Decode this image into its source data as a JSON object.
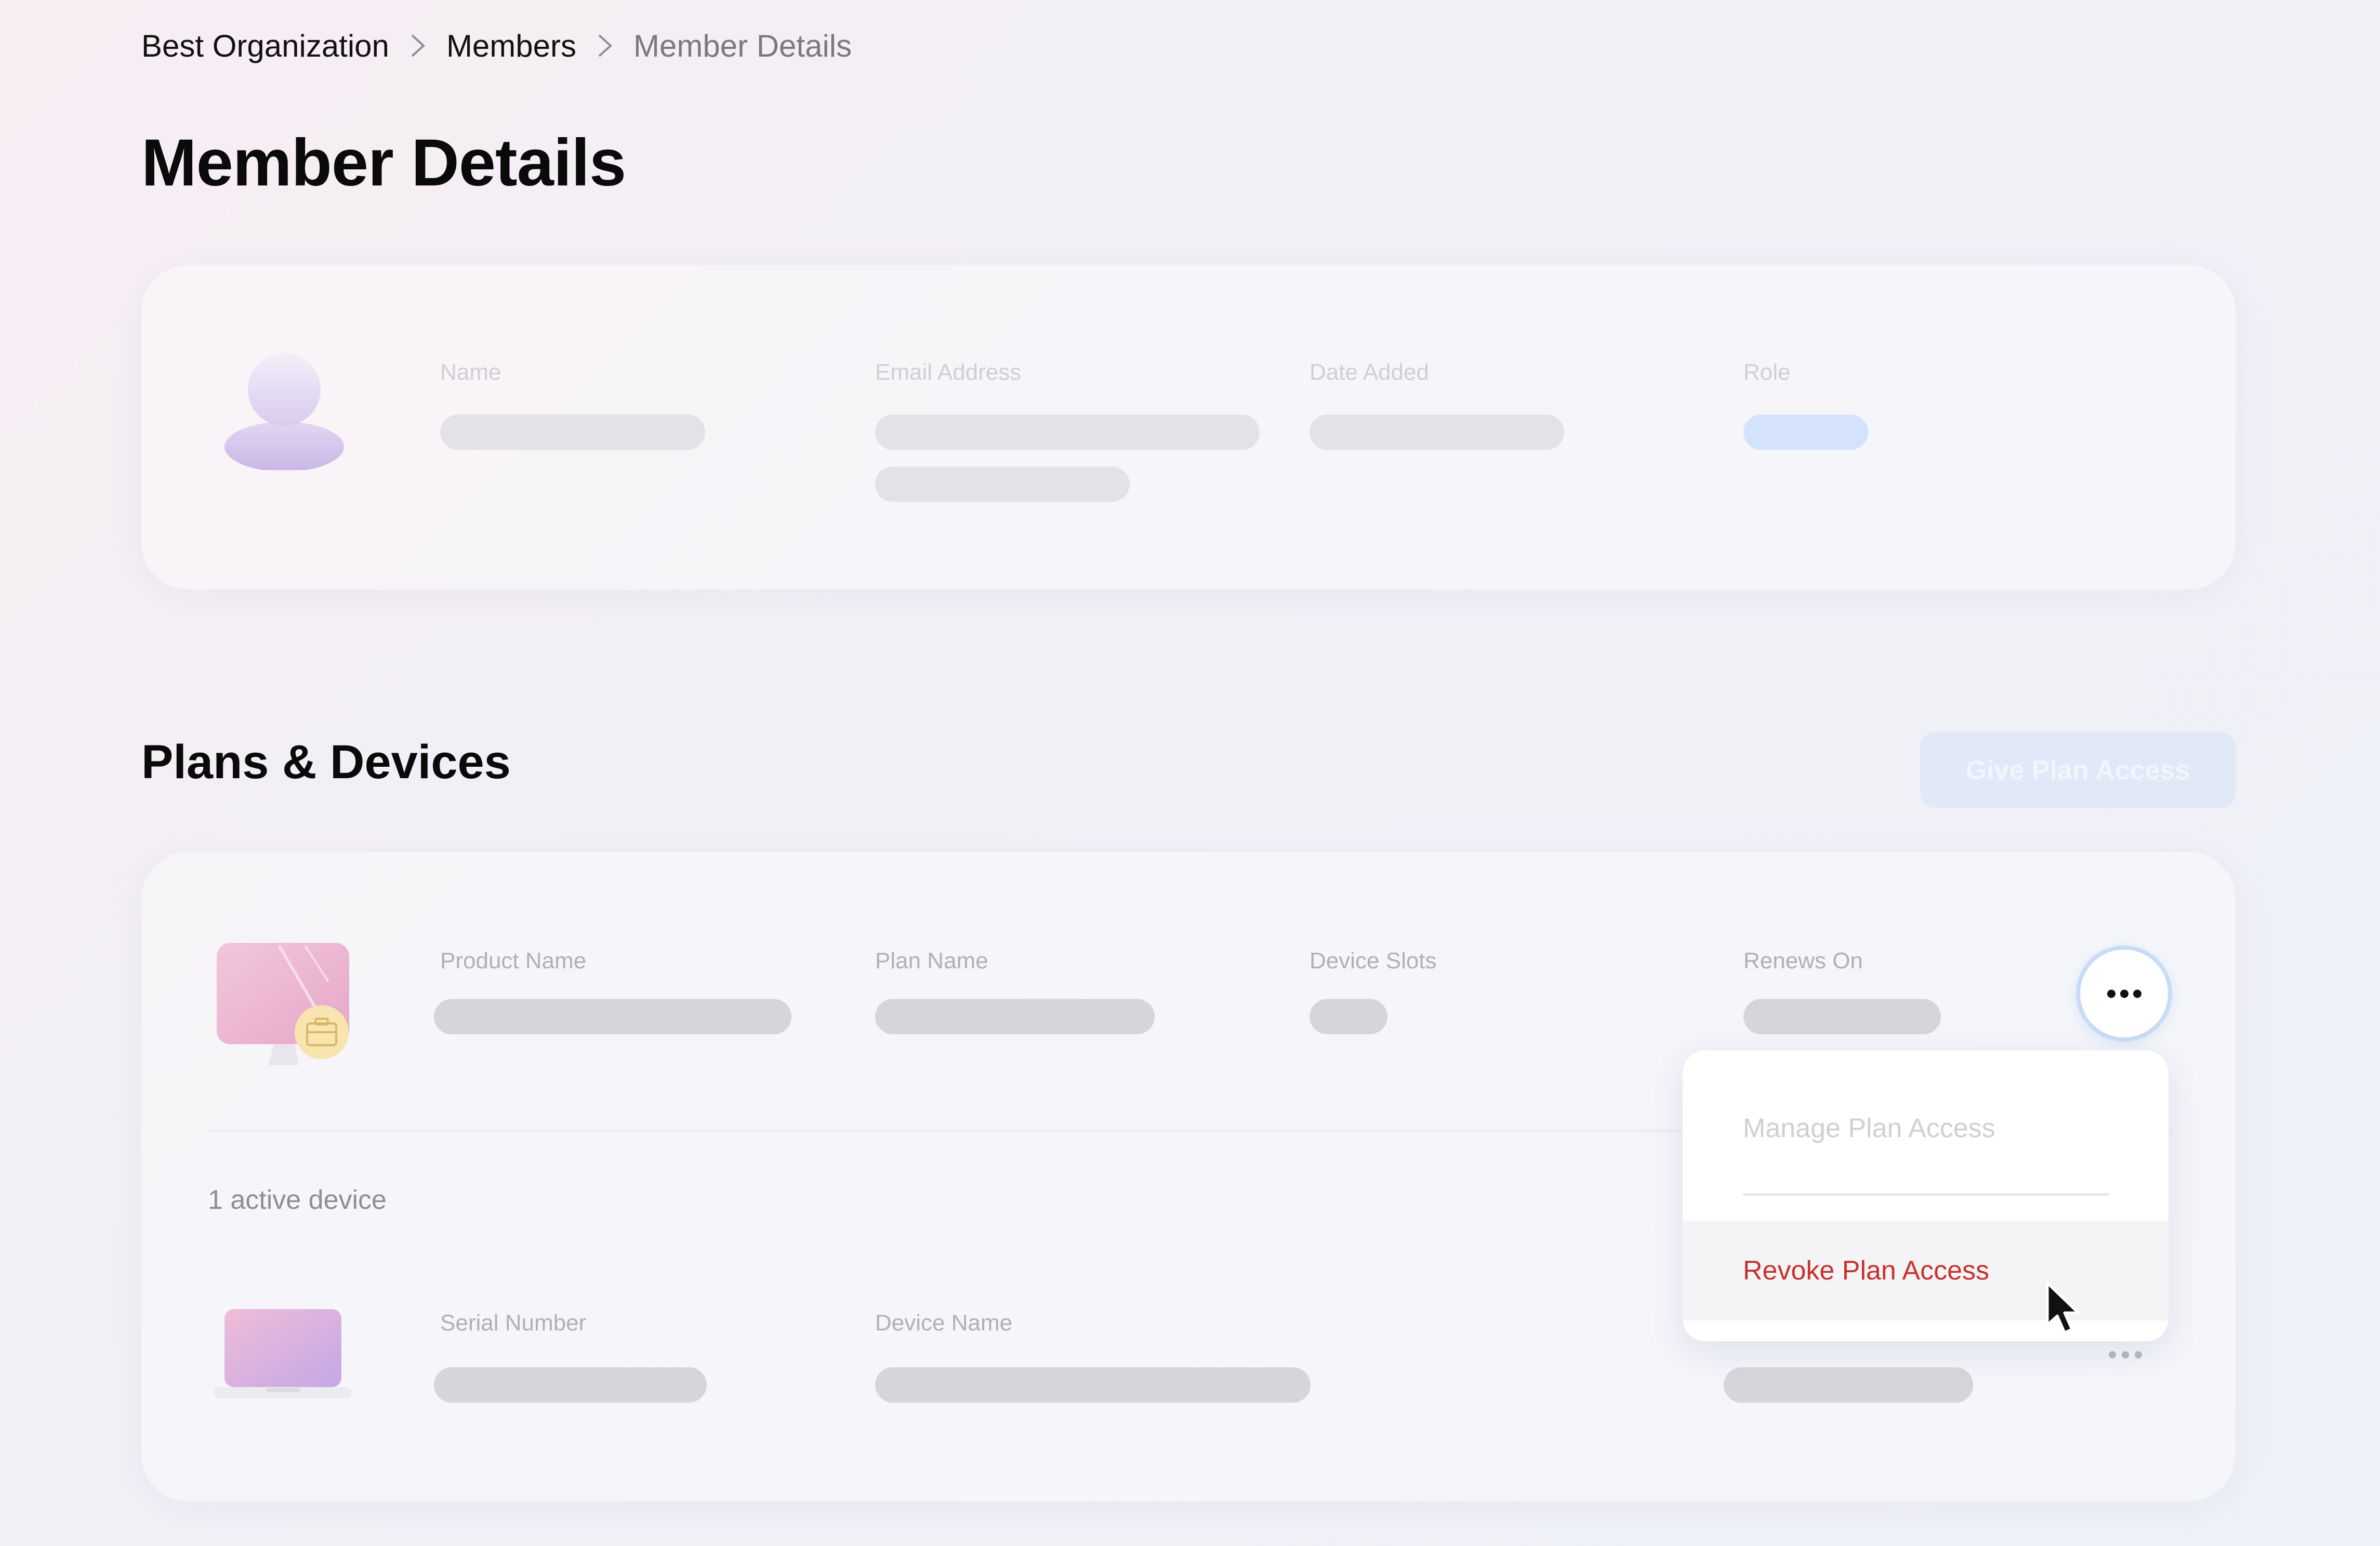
{
  "breadcrumb": {
    "items": [
      "Best Organization",
      "Members",
      "Member Details"
    ]
  },
  "page_title": "Member Details",
  "member_card": {
    "labels": {
      "name": "Name",
      "email": "Email Address",
      "date_added": "Date Added",
      "role": "Role"
    }
  },
  "plans_section": {
    "title": "Plans & Devices",
    "give_button": "Give Plan Access",
    "plan_labels": {
      "product_name": "Product Name",
      "plan_name": "Plan Name",
      "device_slots": "Device Slots",
      "renews_on": "Renews On"
    },
    "active_devices": "1 active device",
    "device_labels": {
      "serial_number": "Serial Number",
      "device_name": "Device Name"
    }
  },
  "dropdown": {
    "items": [
      "Manage Plan Access",
      "Revoke Plan Access"
    ]
  },
  "colors": {
    "accent": "#c9dcf5",
    "danger": "#c9302c",
    "skeleton": "#e3e2e7"
  },
  "icons": [
    "chevron-right-icon",
    "avatar-placeholder-icon",
    "imac-icon",
    "briefcase-icon",
    "laptop-icon",
    "more-horizontal-icon",
    "cursor-icon"
  ]
}
